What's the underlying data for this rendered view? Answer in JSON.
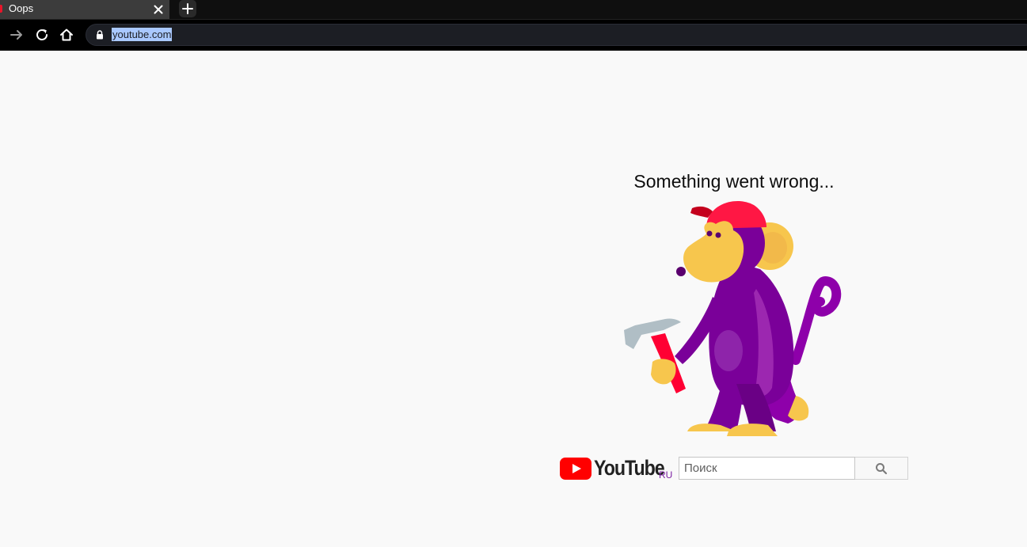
{
  "browser": {
    "tab": {
      "title": "Oops",
      "close_icon": "close-icon"
    },
    "new_tab_icon": "plus-icon",
    "nav": {
      "forward_icon": "arrow-right-icon",
      "reload_icon": "reload-icon",
      "home_icon": "home-icon"
    },
    "address_bar": {
      "lock_icon": "lock-icon",
      "url": "youtube.com",
      "url_selected": true
    }
  },
  "page": {
    "error_title": "Something went wrong...",
    "illustration": "monkey-with-hammer",
    "logo": {
      "wordmark": "YouTube",
      "region": "RU",
      "brand_color": "#ff0000"
    },
    "search": {
      "placeholder": "Поиск",
      "value": "",
      "button_icon": "search-icon"
    }
  }
}
